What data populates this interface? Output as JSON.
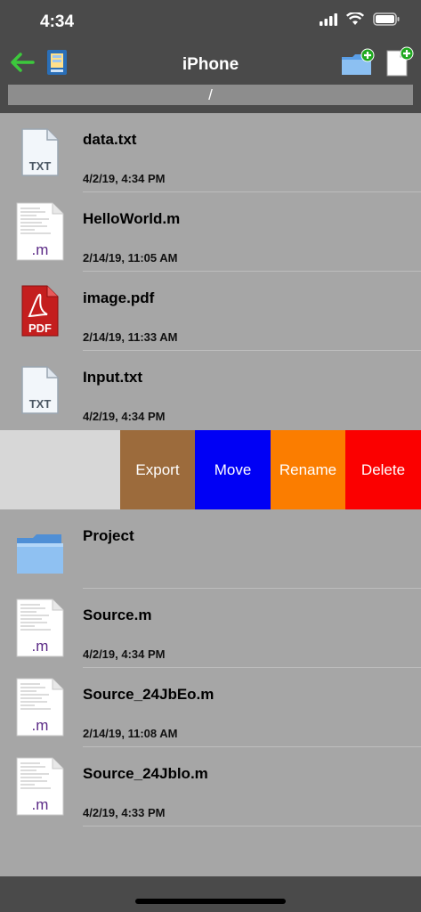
{
  "status": {
    "time": "4:34"
  },
  "nav": {
    "title": "iPhone",
    "path": "/"
  },
  "files": [
    {
      "name": "data.txt",
      "date": "4/2/19, 4:34 PM",
      "type": "txt",
      "icon_label": "TXT"
    },
    {
      "name": "HelloWorld.m",
      "date": "2/14/19, 11:05 AM",
      "type": "m",
      "icon_label": ".m"
    },
    {
      "name": "image.pdf",
      "date": "2/14/19, 11:33 AM",
      "type": "pdf",
      "icon_label": "PDF"
    },
    {
      "name": "Input.txt",
      "date": "4/2/19, 4:34 PM",
      "type": "txt",
      "icon_label": "TXT"
    },
    {
      "name": "Project",
      "date": "",
      "type": "folder"
    },
    {
      "name": "Source.m",
      "date": "4/2/19, 4:34 PM",
      "type": "m",
      "icon_label": ".m"
    },
    {
      "name": "Source_24JbEo.m",
      "date": "2/14/19, 11:08 AM",
      "type": "m",
      "icon_label": ".m"
    },
    {
      "name": "Source_24Jblo.m",
      "date": "4/2/19, 4:33 PM",
      "type": "m",
      "icon_label": ".m"
    }
  ],
  "swipe_actions": {
    "export": "Export",
    "move": "Move",
    "rename": "Rename",
    "delete": "Delete"
  },
  "colors": {
    "export": "#9c6b3c",
    "move": "#0000f5",
    "rename": "#fb7d00",
    "delete": "#fb0000",
    "back_arrow": "#3cc93c",
    "bar": "#4a4a4a"
  }
}
